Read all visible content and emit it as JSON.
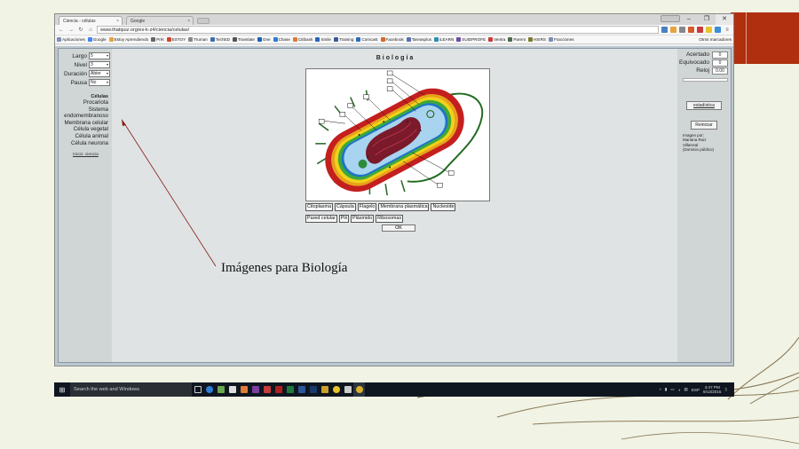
{
  "browser": {
    "tabs": [
      {
        "label": "Ciencia - células",
        "active": true
      },
      {
        "label": "Google",
        "active": false
      }
    ],
    "url": "www.thatquiz.org/es-k-z4/ciencia/celulas/",
    "bookmarks": [
      "Aplicaciones",
      "Google",
      "Estoy Aprendiendo",
      "Prét",
      "ESTOY",
      "Truman",
      "TechED",
      "Translate",
      "One",
      "Chase",
      "Citibank",
      "Smile",
      "Training",
      "Comcast",
      "Facebook",
      "Tareasplus",
      "iLEARN",
      "SUIDPROFE",
      "Ventra",
      "Parent",
      "HSIRS",
      "Fracciones"
    ],
    "bookmarks_other": "Otros marcadores"
  },
  "left_panel": {
    "controls": [
      {
        "label": "Largo",
        "value": "5"
      },
      {
        "label": "Nivel",
        "value": "3"
      },
      {
        "label": "Duración",
        "value": "Abier"
      },
      {
        "label": "Pausa",
        "value": "No"
      }
    ],
    "topics_title": "Células",
    "topics": [
      "Procariota",
      "Sistema",
      "endomembranoso",
      "Membrana celular",
      "Célula vegetal",
      "Célula animal",
      "Célula neurona"
    ],
    "home_link": "Inicio: ciencia"
  },
  "right_panel": {
    "acertado_label": "Acertado",
    "acertado_value": "0",
    "equivocado_label": "Equivocado",
    "equivocado_value": "0",
    "reloj_label": "Reloj",
    "reloj_value": "0.00",
    "estadisticas": "estadística",
    "reiniciar": "Reiniciar",
    "credit": [
      "Imagen por:",
      "Mariana Ruiz",
      "Villarreal",
      "(Dominio público)"
    ]
  },
  "main": {
    "title": "Biología",
    "labels": [
      "Citoplasma",
      "Cápsula",
      "Flagelo",
      "Membrana plasmática",
      "Nucleoide",
      "Pared celular",
      "Pili",
      "Plásmido",
      "Ribosomas"
    ],
    "ok": "OK"
  },
  "annotation": "Imágenes para Biología",
  "taskbar": {
    "search": "Search the web and Windows",
    "lang": "ESP",
    "time": "4:47 PM",
    "date": "9/13/2015"
  }
}
